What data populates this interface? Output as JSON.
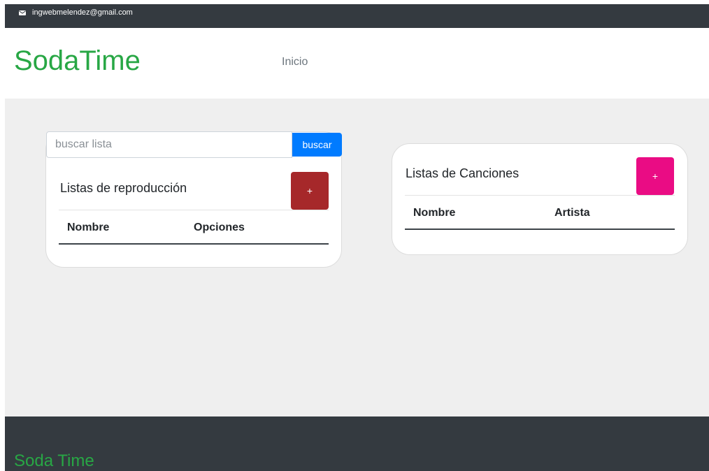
{
  "topbar": {
    "email": "ingwebmelendez@gmail.com",
    "email_icon": "envelope-icon"
  },
  "header": {
    "brand": "SodaTime",
    "nav": {
      "inicio": "Inicio"
    }
  },
  "playlists": {
    "search_placeholder": "buscar lista",
    "search_value": "",
    "search_button": "buscar",
    "title": "Listas de reproducción",
    "add_button": "+",
    "columns": [
      "Nombre",
      "Opciones"
    ],
    "rows": []
  },
  "songs": {
    "title": "Listas de Canciones",
    "add_button": "+",
    "columns": [
      "Nombre",
      "Artista"
    ],
    "rows": []
  },
  "footer": {
    "brand": "Soda Time"
  },
  "colors": {
    "brand_green": "#28a745",
    "dark_bar": "#343a40",
    "main_bg": "#efefef",
    "search_button": "#007bff",
    "playlist_add_button": "#a6282a",
    "song_add_button": "#ea0c84"
  }
}
